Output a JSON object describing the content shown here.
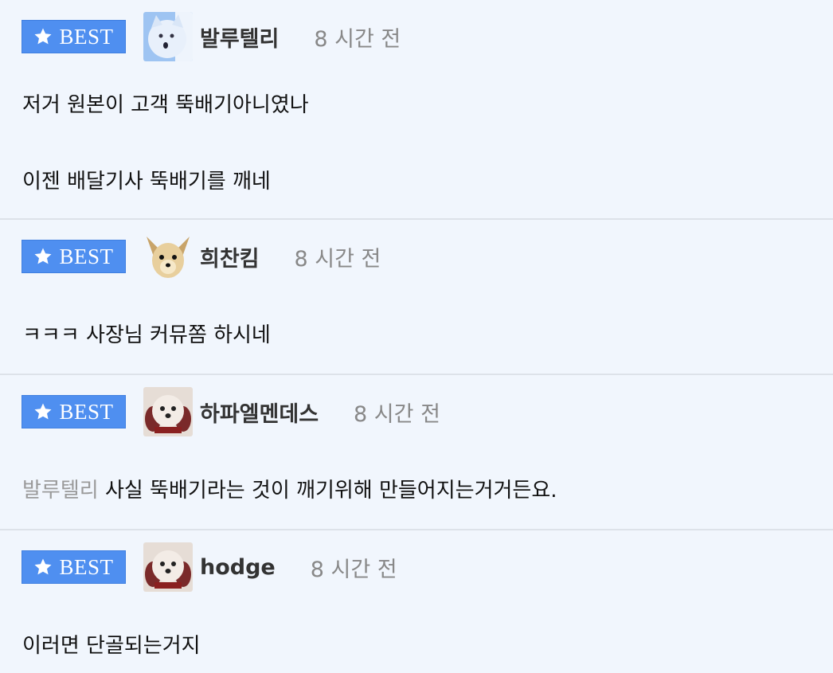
{
  "badge_label": "BEST",
  "comments": [
    {
      "nickname": "발루텔리",
      "time": "8 시간 전",
      "avatar_icon": "white-dog-avatar",
      "lines": [
        "저거 원본이 고객 뚝배기아니였나",
        "이젠 배달기사 뚝배기를 깨네"
      ]
    },
    {
      "nickname": "희찬킴",
      "time": "8 시간 전",
      "avatar_icon": "fox-dog-avatar",
      "lines": [
        "ㅋㅋㅋ 사장님 커뮤쫌 하시네"
      ]
    },
    {
      "nickname": "하파엘멘데스",
      "time": "8 시간 전",
      "avatar_icon": "puppy-avatar",
      "mention": "발루텔리",
      "lines": [
        "사실 뚝배기라는 것이 깨기위해 만들어지는거거든요."
      ]
    },
    {
      "nickname": "hodge",
      "time": "8 시간 전",
      "avatar_icon": "puppy-avatar",
      "lines": [
        "이러면 단골되는거지"
      ]
    }
  ],
  "colors": {
    "badge": "#4f8ff0",
    "background": "#f1f6fd",
    "divider": "#dde2e9",
    "time": "#888888"
  }
}
